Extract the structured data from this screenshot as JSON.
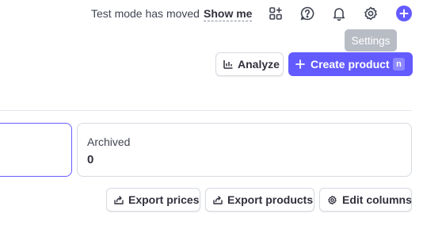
{
  "topbar": {
    "notice": "Test mode has moved",
    "show_me": "Show me",
    "icons": [
      "apps-icon",
      "help-icon",
      "bell-icon",
      "gear-icon",
      "plus-circle-icon"
    ]
  },
  "tooltip": {
    "text": "Settings"
  },
  "actions": {
    "analyze": "Analyze",
    "create_product": "Create product",
    "create_shortcut": "n"
  },
  "cards": {
    "archived": {
      "label": "Archived",
      "count": "0"
    }
  },
  "export_bar": {
    "export_prices": "Export prices",
    "export_products": "Export products",
    "edit_columns": "Edit columns"
  },
  "colors": {
    "accent": "#635bff",
    "text": "#30313d",
    "border": "#d5dbe1",
    "tooltip_bg": "#b8bcc5"
  }
}
